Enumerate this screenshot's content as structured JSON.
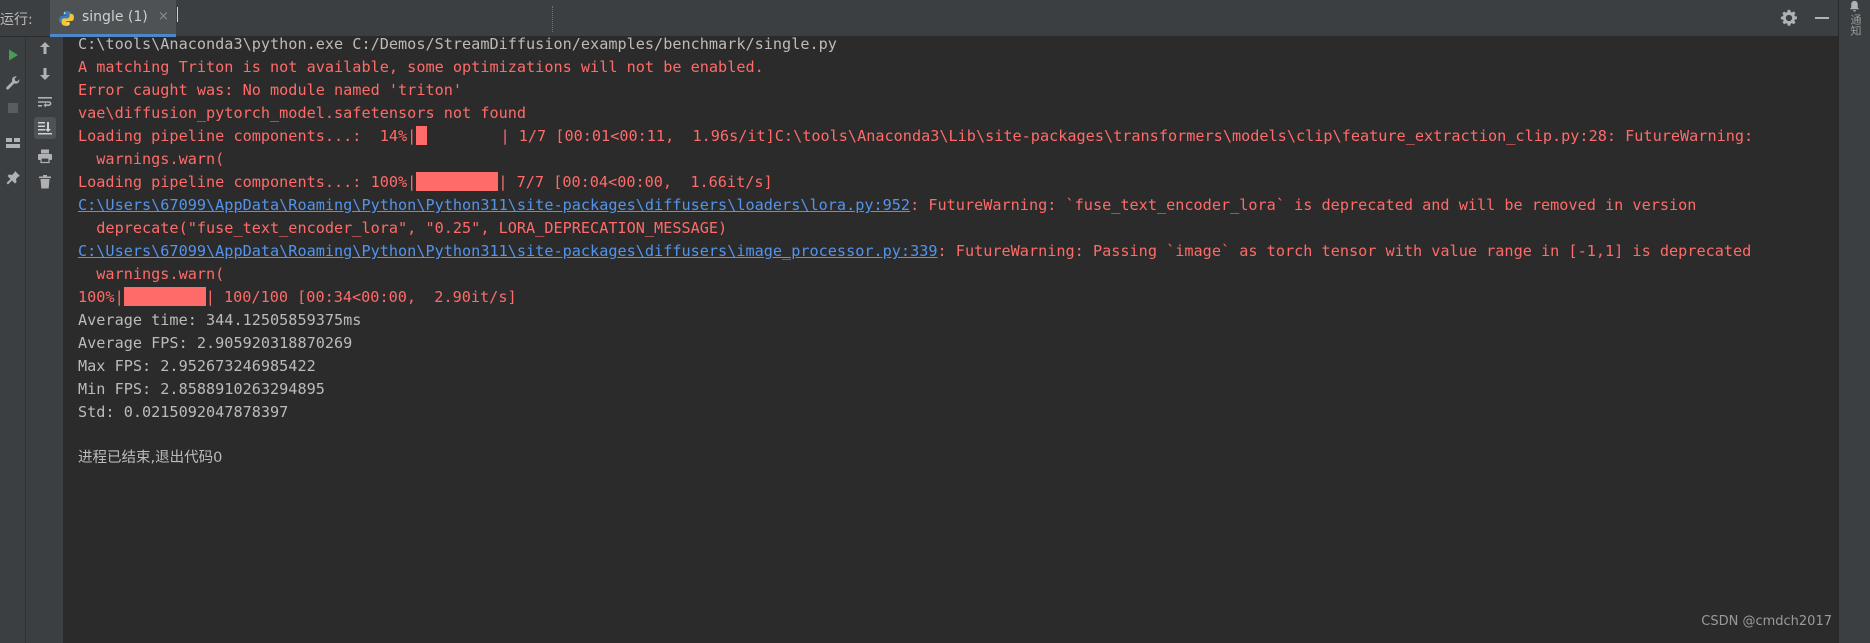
{
  "header": {
    "run_label": "运行:",
    "tab_label": "single (1)",
    "tab_close": "×"
  },
  "right_panel": {
    "notifications_label": "通知"
  },
  "toolbar_left": {
    "icons": [
      "run-icon",
      "wrench-icon",
      "stop-icon",
      "layout-icon",
      "pin-icon"
    ]
  },
  "toolbar_right": {
    "icons": [
      "arrow-up-icon",
      "arrow-down-icon",
      "soft-wrap-icon",
      "scroll-to-end-icon",
      "print-icon",
      "trash-icon"
    ]
  },
  "console": {
    "l1": "C:\\tools\\Anaconda3\\python.exe C:/Demos/StreamDiffusion/examples/benchmark/single.py",
    "l2": "A matching Triton is not available, some optimizations will not be enabled.",
    "l3": "Error caught was: No module named 'triton'",
    "l4": "vae\\diffusion_pytorch_model.safetensors not found",
    "l5_prefix": "Loading pipeline components...:  14%|",
    "l5_progress": 0.14,
    "l5_suffix": "        | 1/7 [00:01<00:11,  1.96s/it]C:\\tools\\Anaconda3\\Lib\\site-packages\\transformers\\models\\clip\\feature_extraction_clip.py:28: FutureWarning:",
    "l6": "  warnings.warn(",
    "l7_prefix": "Loading pipeline components...: 100%|",
    "l7_progress": 1.0,
    "l7_suffix": "| 7/7 [00:04<00:00,  1.66it/s]",
    "l8_link": "C:\\Users\\67099\\AppData\\Roaming\\Python\\Python311\\site-packages\\diffusers\\loaders\\lora.py:952",
    "l8_text": ": FutureWarning: `fuse_text_encoder_lora` is deprecated and will be removed in version",
    "l9": "  deprecate(\"fuse_text_encoder_lora\", \"0.25\", LORA_DEPRECATION_MESSAGE)",
    "l10_link": "C:\\Users\\67099\\AppData\\Roaming\\Python\\Python311\\site-packages\\diffusers\\image_processor.py:339",
    "l10_text": ": FutureWarning: Passing `image` as torch tensor with value range in [-1,1] is deprecated",
    "l11": "  warnings.warn(",
    "l12_prefix": "100%|",
    "l12_progress": 1.0,
    "l12_suffix": "| 100/100 [00:34<00:00,  2.90it/s]",
    "l13": "Average time: 344.12505859375ms",
    "l14": "Average FPS: 2.905920318870269",
    "l15": "Max FPS: 2.952673246985422",
    "l16": "Min FPS: 2.8588910263294895",
    "l17": "Std: 0.0215092047878397",
    "l18": "进程已结束,退出代码0"
  },
  "watermark": "CSDN @cmdch2017",
  "colors": {
    "background": "#2b2b2b",
    "error": "#ff6b68",
    "link": "#5394ec",
    "plain": "#bbbbbb",
    "tab_underline": "#4a88c7",
    "run_green": "#499c54"
  }
}
